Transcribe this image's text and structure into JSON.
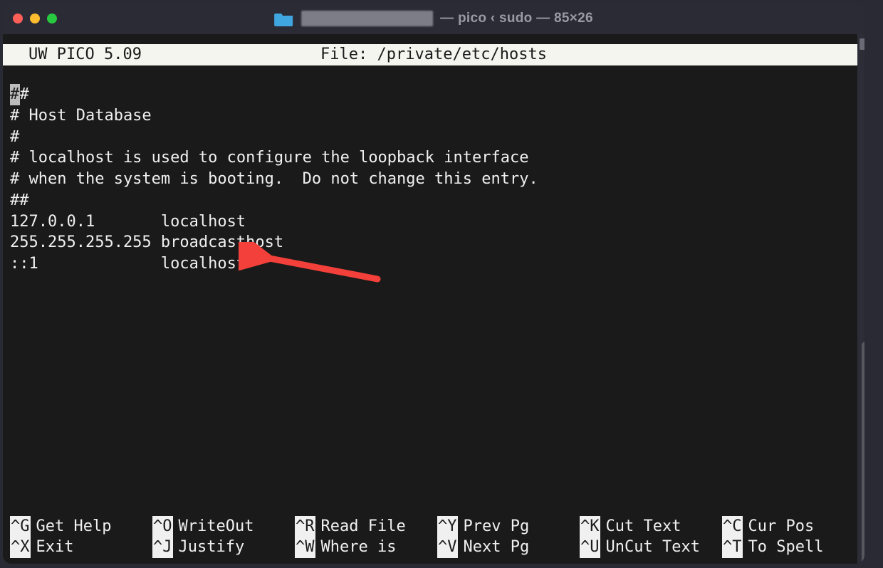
{
  "window": {
    "title_suffix": "— pico ‹ sudo — 85×26"
  },
  "header": {
    "app": "UW PICO 5.09",
    "file_label": "File: /private/etc/hosts"
  },
  "file_lines": [
    "##",
    "# Host Database",
    "#",
    "# localhost is used to configure the loopback interface",
    "# when the system is booting.  Do not change this entry.",
    "##",
    "127.0.0.1       localhost",
    "255.255.255.255 broadcasthost",
    "::1             localhost"
  ],
  "cursor_char": "#",
  "shortcuts": {
    "row1": [
      {
        "key": "^G",
        "label": "Get Help"
      },
      {
        "key": "^O",
        "label": "WriteOut"
      },
      {
        "key": "^R",
        "label": "Read File"
      },
      {
        "key": "^Y",
        "label": "Prev Pg"
      },
      {
        "key": "^K",
        "label": "Cut Text"
      },
      {
        "key": "^C",
        "label": "Cur Pos"
      }
    ],
    "row2": [
      {
        "key": "^X",
        "label": "Exit"
      },
      {
        "key": "^J",
        "label": "Justify"
      },
      {
        "key": "^W",
        "label": "Where is"
      },
      {
        "key": "^V",
        "label": "Next Pg"
      },
      {
        "key": "^U",
        "label": "UnCut Text"
      },
      {
        "key": "^T",
        "label": "To Spell"
      }
    ]
  }
}
